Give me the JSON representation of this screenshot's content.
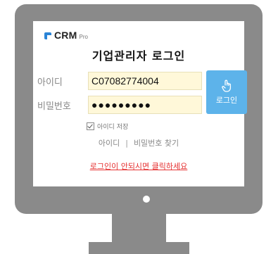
{
  "logo": {
    "name": "CRM",
    "sub": "Pro"
  },
  "title": "기업관리자 로그인",
  "form": {
    "id_label": "아이디",
    "id_value": "C07082774004",
    "pw_label": "비밀번호",
    "pw_value": "●●●●●●●●●",
    "login_label": "로그인",
    "save_label": "아이디 저장"
  },
  "links": {
    "find_id": "아이디",
    "separator": "|",
    "find_pw": "비밀번호 찾기",
    "help": "로그인이 안되시면 클릭하세요"
  },
  "colors": {
    "login_button": "#5db3ea",
    "field_bg": "#fff8d9",
    "help_link": "#e53131",
    "monitor": "#8a8a8a"
  },
  "icons": {
    "login": "hand-pointer-icon",
    "logo": "crm-logo-icon"
  }
}
